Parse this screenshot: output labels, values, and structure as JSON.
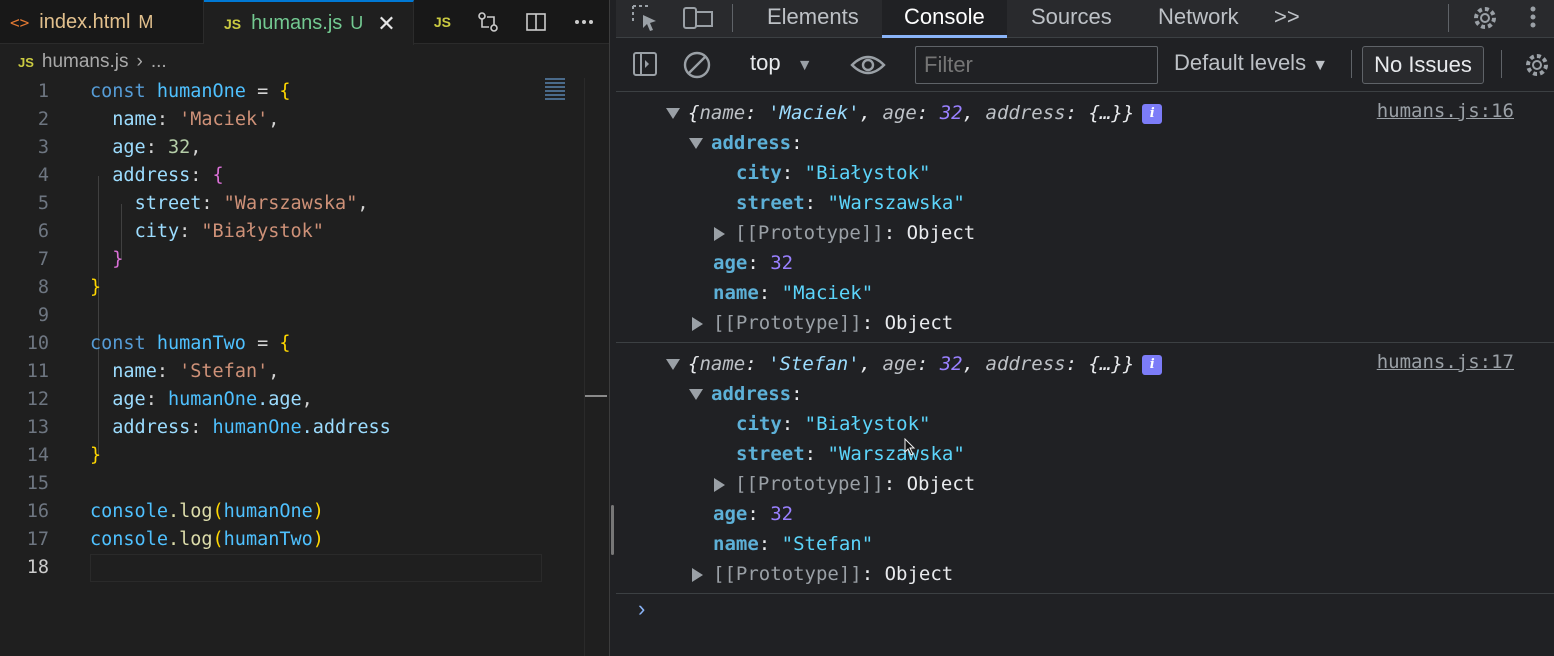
{
  "editor": {
    "tabs": [
      {
        "label": "index.html",
        "badge": "M"
      },
      {
        "label": "humans.js",
        "badge": "U"
      }
    ],
    "actions_js_label": "JS",
    "breadcrumb": {
      "file": "humans.js",
      "rest": "..."
    },
    "file_icon_label": "JS",
    "code_lines": [
      {
        "n": "1"
      },
      {
        "n": "2"
      },
      {
        "n": "3"
      },
      {
        "n": "4"
      },
      {
        "n": "5"
      },
      {
        "n": "6"
      },
      {
        "n": "7"
      },
      {
        "n": "8"
      },
      {
        "n": "9"
      },
      {
        "n": "10"
      },
      {
        "n": "11"
      },
      {
        "n": "12"
      },
      {
        "n": "13"
      },
      {
        "n": "14"
      },
      {
        "n": "15"
      },
      {
        "n": "16"
      },
      {
        "n": "17"
      },
      {
        "n": "18"
      }
    ],
    "tokens": {
      "l1": [
        "const",
        "humanOne",
        "=",
        "{"
      ],
      "l2": [
        "name",
        ":",
        "'Maciek'",
        ","
      ],
      "l3": [
        "age",
        ":",
        "32",
        ","
      ],
      "l4": [
        "address",
        ":",
        "{"
      ],
      "l5": [
        "street",
        ":",
        "\"Warszawska\"",
        ","
      ],
      "l6": [
        "city",
        ":",
        "\"Białystok\""
      ],
      "l7": [
        "}"
      ],
      "l8": [
        "}"
      ],
      "l10": [
        "const",
        "humanTwo",
        "=",
        "{"
      ],
      "l11": [
        "name",
        ":",
        "'Stefan'",
        ","
      ],
      "l12": [
        "age",
        ":",
        "humanOne",
        ".age",
        ","
      ],
      "l13": [
        "address",
        ":",
        "humanOne",
        ".address"
      ],
      "l14": [
        "}"
      ],
      "l16": [
        "console",
        ".log",
        "(",
        "humanOne",
        ")"
      ],
      "l17": [
        "console",
        ".log",
        "(",
        "humanTwo",
        ")"
      ]
    }
  },
  "devtools": {
    "tabs": [
      "Elements",
      "Console",
      "Sources",
      "Network"
    ],
    "more_tabs": ">>",
    "context": "top",
    "filter_placeholder": "Filter",
    "levels": "Default levels",
    "issues": "No Issues",
    "messages": [
      {
        "summary": {
          "open": "{",
          "k1": "name",
          "v1": "'Maciek'",
          "k2": "age",
          "v2": "32",
          "k3": "address",
          "v3": "{…}",
          "close": "}"
        },
        "source": "humans.js:16",
        "address_key": "address",
        "city_key": "city",
        "city_val": "\"Białystok\"",
        "street_key": "street",
        "street_val": "\"Warszawska\"",
        "proto_inner": "[[Prototype]]",
        "proto_inner_val": "Object",
        "age_key": "age",
        "age_val": "32",
        "name_key": "name",
        "name_val": "\"Maciek\"",
        "proto": "[[Prototype]]",
        "proto_val": "Object"
      },
      {
        "summary": {
          "open": "{",
          "k1": "name",
          "v1": "'Stefan'",
          "k2": "age",
          "v2": "32",
          "k3": "address",
          "v3": "{…}",
          "close": "}"
        },
        "source": "humans.js:17",
        "address_key": "address",
        "city_key": "city",
        "city_val": "\"Białystok\"",
        "street_key": "street",
        "street_val": "\"Warszawska\"",
        "proto_inner": "[[Prototype]]",
        "proto_inner_val": "Object",
        "age_key": "age",
        "age_val": "32",
        "name_key": "name",
        "name_val": "\"Stefan\"",
        "proto": "[[Prototype]]",
        "proto_val": "Object"
      }
    ],
    "info_badge": "i",
    "prompt": "›"
  }
}
